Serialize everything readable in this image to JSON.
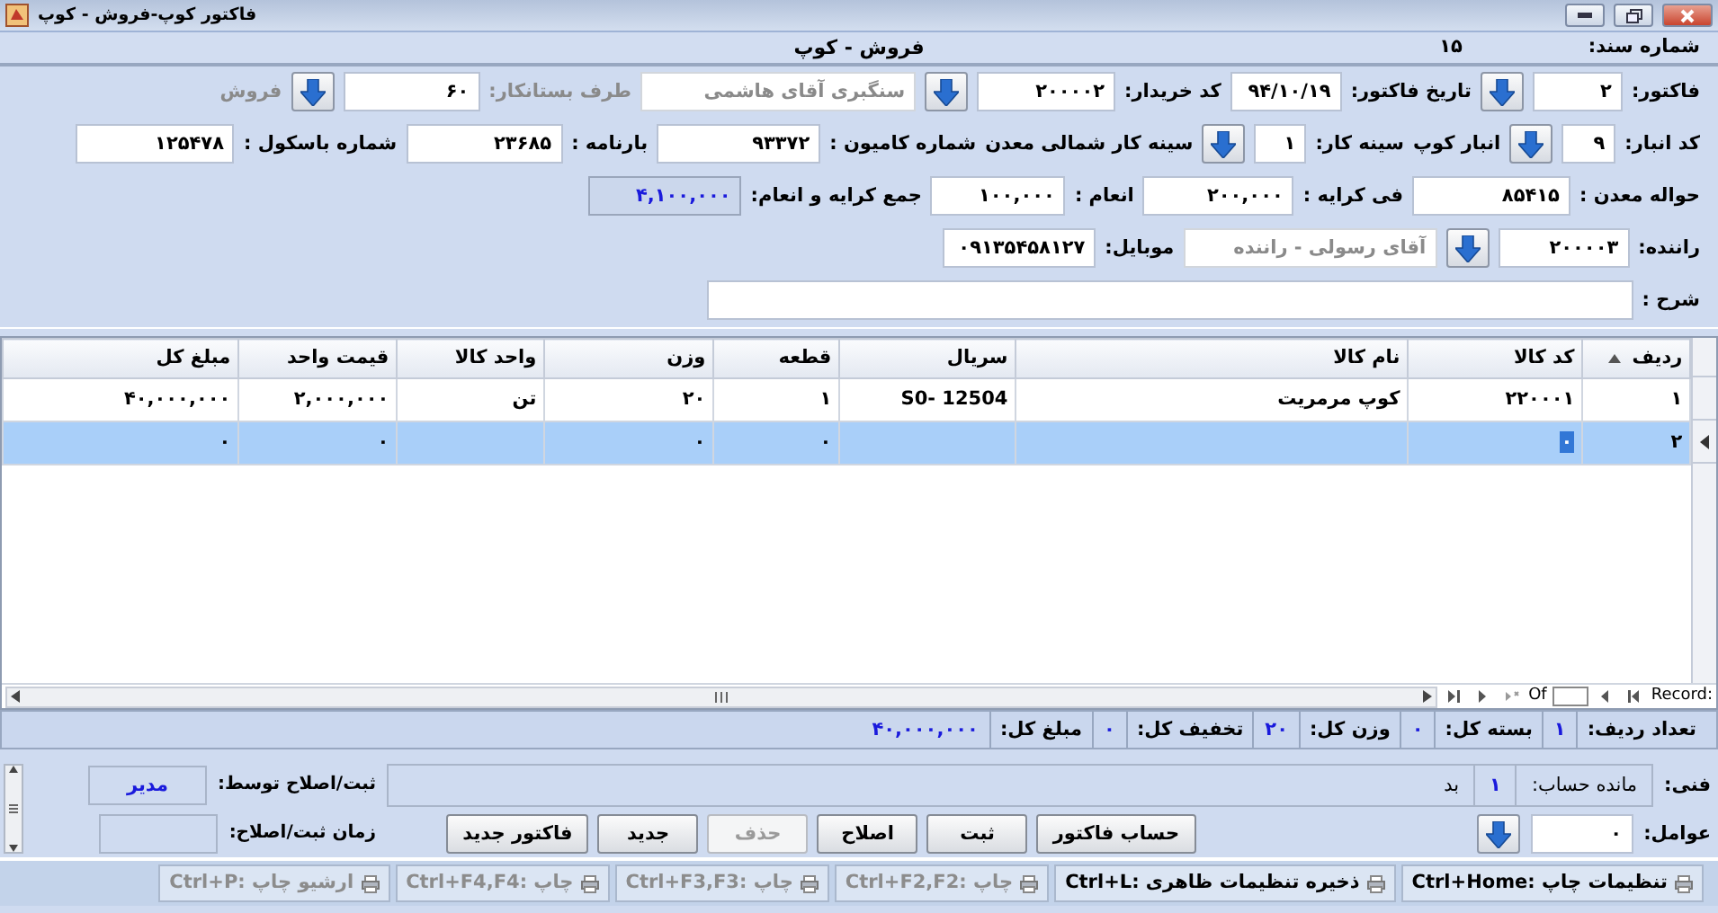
{
  "window": {
    "title": "فاکتور کوپ-فروش - کوپ"
  },
  "header": {
    "doc_label": "شماره سند:",
    "doc_number": "۱۵",
    "title": "فروش - کوپ"
  },
  "form_rows": [
    [
      {
        "kind": "label",
        "text": "فاکتور:",
        "disabled": false
      },
      {
        "kind": "field",
        "value": "۲",
        "disabled": false
      },
      {
        "kind": "lookup"
      },
      {
        "kind": "label",
        "text": "تاریخ فاکتور:",
        "disabled": false
      },
      {
        "kind": "field",
        "value": "۹۴/۱۰/۱۹",
        "disabled": false
      },
      {
        "kind": "label",
        "text": "کد خریدار:",
        "disabled": false
      },
      {
        "kind": "field",
        "value": "۲۰۰۰۰۲",
        "disabled": false
      },
      {
        "kind": "lookup"
      },
      {
        "kind": "field",
        "value": "سنگبری آقای هاشمی",
        "disabled": true
      },
      {
        "kind": "label",
        "text": "طرف بستانکار:",
        "disabled": true
      },
      {
        "kind": "field",
        "value": "۶۰",
        "disabled": false
      },
      {
        "kind": "lookup"
      },
      {
        "kind": "label",
        "text": "فروش",
        "disabled": true
      }
    ],
    [
      {
        "kind": "label",
        "text": "کد انبار:",
        "disabled": false
      },
      {
        "kind": "field",
        "value": "۹",
        "disabled": false
      },
      {
        "kind": "lookup"
      },
      {
        "kind": "label",
        "text": "انبار کوپ",
        "disabled": false
      },
      {
        "kind": "label",
        "text": "سینه کار:",
        "disabled": false
      },
      {
        "kind": "field",
        "value": "۱",
        "disabled": false
      },
      {
        "kind": "lookup"
      },
      {
        "kind": "label",
        "text": "سینه کار شمالی معدن",
        "disabled": false
      },
      {
        "kind": "label",
        "text": "شماره کامیون :",
        "disabled": false
      },
      {
        "kind": "field",
        "value": "۹۳۳۷۲",
        "disabled": false
      },
      {
        "kind": "label",
        "text": "بارنامه :",
        "disabled": false
      },
      {
        "kind": "field",
        "value": "۲۳۶۸۵",
        "disabled": false
      },
      {
        "kind": "label",
        "text": "شماره باسکول :",
        "disabled": false
      },
      {
        "kind": "field",
        "value": "۱۲۵۴۷۸",
        "disabled": false
      }
    ],
    [
      {
        "kind": "label",
        "text": "حواله معدن :",
        "disabled": false
      },
      {
        "kind": "field",
        "value": "۸۵۴۱۵",
        "disabled": false
      },
      {
        "kind": "label",
        "text": "فی کرایه :",
        "disabled": false
      },
      {
        "kind": "field",
        "value": "۲۰۰,۰۰۰",
        "disabled": false
      },
      {
        "kind": "label",
        "text": "انعام :",
        "disabled": false
      },
      {
        "kind": "field",
        "value": "۱۰۰,۰۰۰",
        "disabled": false
      },
      {
        "kind": "label",
        "text": "جمع کرایه و انعام:",
        "disabled": false
      },
      {
        "kind": "total",
        "value": "۴,۱۰۰,۰۰۰"
      }
    ],
    [
      {
        "kind": "label",
        "text": "راننده:",
        "disabled": false
      },
      {
        "kind": "field",
        "value": "۲۰۰۰۰۳",
        "disabled": false
      },
      {
        "kind": "lookup"
      },
      {
        "kind": "field",
        "value": "آقای رسولی - راننده",
        "disabled": true
      },
      {
        "kind": "label",
        "text": "موبایل:",
        "disabled": false
      },
      {
        "kind": "field",
        "value": "۰۹۱۳۵۴۵۸۱۲۷",
        "disabled": false
      }
    ],
    [
      {
        "kind": "label",
        "text": "شرح :",
        "disabled": false
      },
      {
        "kind": "field",
        "disabled": false
      }
    ]
  ],
  "grid": {
    "columns": [
      {
        "label": "ردیف",
        "sorted": true
      },
      {
        "label": "کد کالا",
        "sorted": false
      },
      {
        "label": "نام کالا",
        "sorted": false
      },
      {
        "label": "سریال",
        "sorted": false
      },
      {
        "label": "قطعه",
        "sorted": false
      },
      {
        "label": "وزن",
        "sorted": false
      },
      {
        "label": "واحد کالا",
        "sorted": false
      },
      {
        "label": "قیمت واحد",
        "sorted": false
      },
      {
        "label": "مبلغ کل",
        "sorted": false
      }
    ],
    "rows": [
      {
        "selected": false,
        "cells": [
          {
            "text": "۱",
            "focused": false
          },
          {
            "text": "۲۲۰۰۰۱",
            "focused": false
          },
          {
            "text": "کوپ مرمریت",
            "focused": false
          },
          {
            "text": "S0- 12504",
            "focused": false
          },
          {
            "text": "۱",
            "focused": false
          },
          {
            "text": "۲۰",
            "focused": false
          },
          {
            "text": "تن",
            "focused": false
          },
          {
            "text": "۲,۰۰۰,۰۰۰",
            "focused": false
          },
          {
            "text": "۴۰,۰۰۰,۰۰۰",
            "focused": false
          }
        ]
      },
      {
        "selected": true,
        "cells": [
          {
            "text": "۲",
            "focused": false
          },
          {
            "text": "۰",
            "focused": true
          },
          {
            "focused": false
          },
          {
            "focused": false
          },
          {
            "text": "۰",
            "focused": false
          },
          {
            "text": "۰",
            "focused": false
          },
          {
            "focused": false
          },
          {
            "text": "۰",
            "focused": false
          },
          {
            "text": "۰",
            "focused": false
          }
        ]
      }
    ],
    "navigator": {
      "label": "Record:",
      "of": "Of"
    }
  },
  "totals": [
    {
      "label": "تعداد ردیف:",
      "value": "۱"
    },
    {
      "label": "بسته کل:",
      "value": "۰"
    },
    {
      "label": "وزن کل:",
      "value": "۲۰"
    },
    {
      "label": "تخفیف کل:",
      "value": "۰"
    },
    {
      "label": "مبلغ کل:",
      "value": "۴۰,۰۰۰,۰۰۰"
    }
  ],
  "notes": {
    "label": "فنی:",
    "balance_label": "مانده حساب:",
    "balance_value": "۱",
    "balance_side": "بد"
  },
  "agents": {
    "label": "عوامل:",
    "value": "۰"
  },
  "buttons": [
    {
      "label": "حساب فاکتور",
      "disabled": false
    },
    {
      "label": "ثبت",
      "disabled": false
    },
    {
      "label": "اصلاح",
      "disabled": false
    },
    {
      "label": "حذف",
      "disabled": true
    },
    {
      "label": "جدید",
      "disabled": false
    },
    {
      "label": "فاکتور جدید",
      "disabled": false
    }
  ],
  "audit": [
    {
      "label": "ثبت/اصلاح توسط:",
      "value": "مدیر"
    },
    {
      "label": "زمان ثبت/اصلاح:"
    }
  ],
  "status_bar": [
    {
      "text": "تنظیمات چاپ :Ctrl+Home",
      "disabled": false
    },
    {
      "text": "ذخیره تنظیمات ظاهری :Ctrl+L",
      "disabled": false
    },
    {
      "text": "چاپ :Ctrl+F2,F2",
      "disabled": true
    },
    {
      "text": "چاپ :Ctrl+F3,F3",
      "disabled": true
    },
    {
      "text": "چاپ :Ctrl+F4,F4",
      "disabled": true
    },
    {
      "text": "ارشیو چاپ :Ctrl+P",
      "disabled": true
    }
  ]
}
